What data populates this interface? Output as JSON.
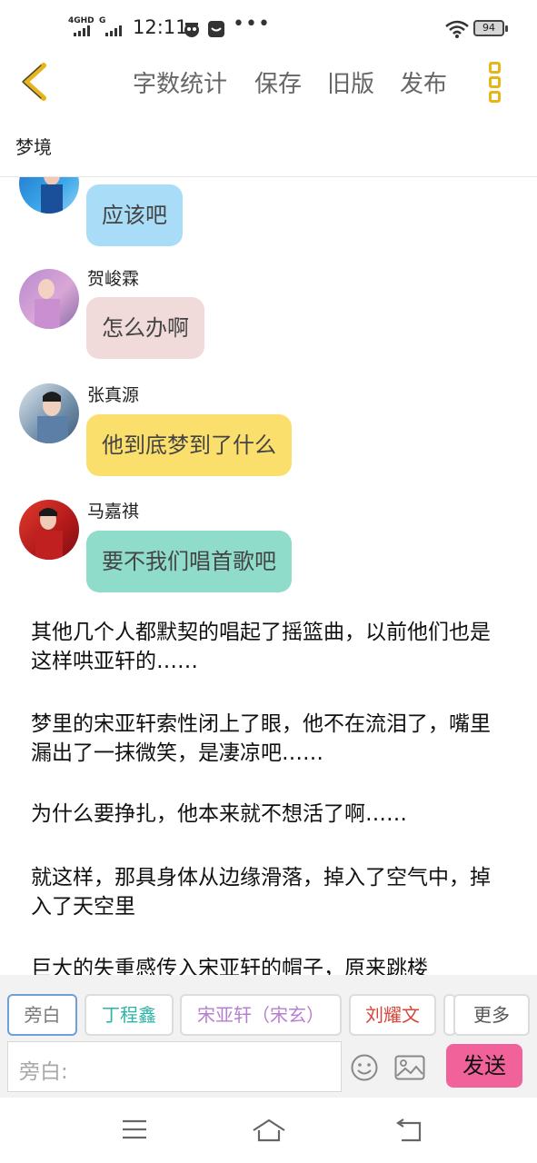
{
  "status_bar": {
    "network1": "4GHD",
    "network2": "G",
    "time": "12:11",
    "battery": "94",
    "more_indicator": "•••",
    "icons": [
      "signal-icon",
      "app-notification-icon",
      "wifi-icon",
      "battery-icon"
    ]
  },
  "toolbar": {
    "word_count": "字数统计",
    "save": "保存",
    "old_version": "旧版",
    "publish": "发布"
  },
  "story": {
    "title": "梦境"
  },
  "messages": [
    {
      "sender": "",
      "text": "应该吧",
      "color": "#a9dcf7"
    },
    {
      "sender": "贺峻霖",
      "text": "怎么办啊",
      "color": "#f1dada"
    },
    {
      "sender": "张真源",
      "text": "他到底梦到了什么",
      "color": "#fbdf6c"
    },
    {
      "sender": "马嘉祺",
      "text": "要不我们唱首歌吧",
      "color": "#8fdccb"
    }
  ],
  "narration": [
    "其他几个人都默契的唱起了摇篮曲，以前他们也是这样哄亚轩的……",
    "梦里的宋亚轩索性闭上了眼，他不在流泪了，嘴里漏出了一抹微笑，是凄凉吧……",
    "为什么要挣扎，他本来就不想活了啊……",
    "就这样，那具身体从边缘滑落，掉入了空气中，掉入了天空里",
    "巨大的失重感传入宋亚轩的帽子，原来跳楼"
  ],
  "roles": [
    {
      "label": "旁白",
      "color": "#7a7a7a"
    },
    {
      "label": "丁程鑫",
      "color": "#2bb5a5"
    },
    {
      "label": "宋亚轩（宋玄）",
      "color": "#b57fd0"
    },
    {
      "label": "刘耀文",
      "color": "#d8453a"
    },
    {
      "label": "",
      "color": "#999999"
    },
    {
      "label": "更多",
      "color": "#555555"
    }
  ],
  "compose": {
    "placeholder": "旁白:",
    "send": "发送"
  },
  "colors": {
    "accent_back": "#e7b41a",
    "send_button": "#f2629a",
    "active_role_border": "#6f9fd8"
  }
}
